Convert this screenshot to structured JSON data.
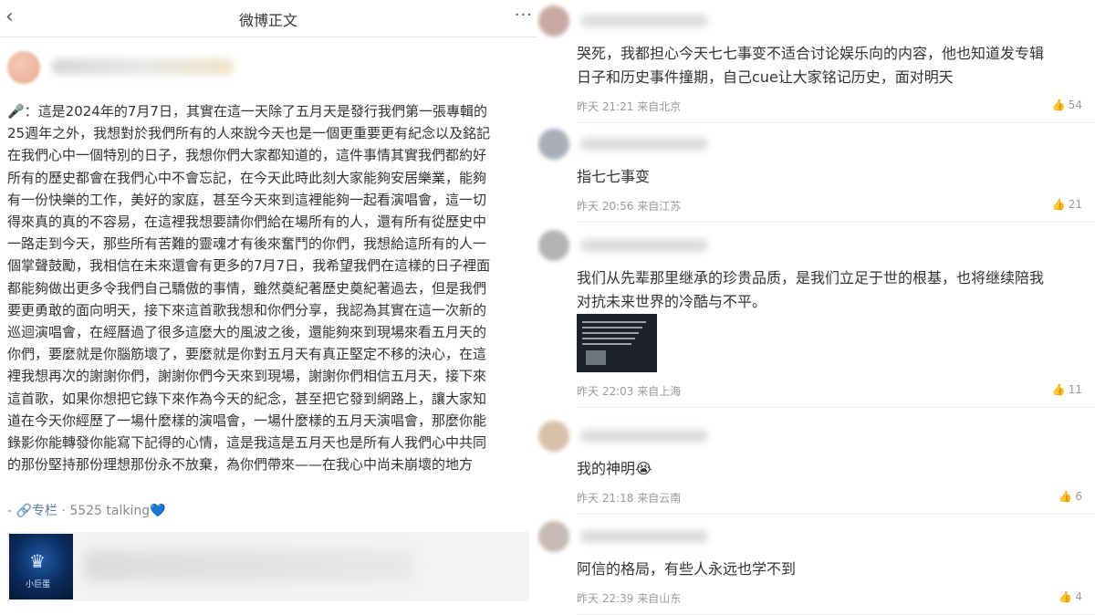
{
  "left_panel": {
    "topbar": {
      "back_icon": "‹",
      "title": "微博正文",
      "more_icon": "···"
    },
    "post_lines": [
      "🎤：這是2024年的7月7日，其實在這一天除了五月天是發行我們第一張專輯的",
      "25週年之外，我想對於我們所有的人來說今天也是一個更重要更有紀念以及銘記",
      "在我們心中一個特別的日子，我想你們大家都知道的，這件事情其實我們都約好",
      "所有的歷史都會在我們心中不會忘記，在今天此時此刻大家能夠安居樂業，能夠",
      "有一份快樂的工作，美好的家庭，甚至今天來到這裡能夠一起看演唱會，這一切",
      "得來真的真的不容易，在這裡我想要請你們給在場所有的人，還有所有從歷史中",
      "一路走到今天，那些所有苦難的靈魂才有後來奮鬥的你們，我想給這所有的人一",
      "個掌聲鼓勵，我相信在未來還會有更多的7月7日，我希望我們在這樣的日子裡面",
      "都能夠做出更多令我們自己驕傲的事情，雖然奠紀著歷史奠紀著過去，但是我們",
      "要更勇敢的面向明天，接下來這首歌我想和你們分享，我認為其實在這一次新的",
      "巡迴演唱會，在經曆過了很多這麼大的風波之後，還能夠來到現場來看五月天的",
      "你們，要麼就是你腦筋壞了，要麼就是你對五月天有真正堅定不移的決心，在這",
      "裡我想再次的謝謝你們，謝謝你們今天來到現場，謝謝你們相信五月天，接下來",
      "這首歌，如果你想把它錄下來作為今天的紀念，甚至把它發到網路上，讓大家知",
      "道在今天你經歷了一場什麼樣的演唱會，一場什麼樣的五月天演唱會，那麼你能",
      "錄影你能轉發你能寫下記得的心情，這是我這是五月天也是所有人我們心中共同",
      "的那份堅持那份理想那份永不放棄，為你們帶來——在我心中尚未崩壞的地方"
    ],
    "meta": {
      "prefix": "- ",
      "link_icon": "🔗",
      "column_label": "专栏",
      "separator": " · ",
      "talking_label": "5525 talking",
      "heart_icon": "💙"
    },
    "card": {
      "thumb_logo": "♛",
      "thumb_sub": "小巨蛋"
    }
  },
  "comments": [
    {
      "lines": [
        "哭死，我都担心今天七七事变不适合讨论娱乐向的内容，他也知道发专辑",
        "日子和历史事件撞期，自己cue让大家铭记历史，面对明天"
      ],
      "meta": "昨天 21:21 来自北京",
      "likes": "54",
      "avatar_color": "#c9a9a4"
    },
    {
      "lines": [
        "指七七事变"
      ],
      "meta": "昨天 20:56 来自江苏",
      "likes": "21",
      "avatar_color": "#a9aeb8"
    },
    {
      "lines": [
        "我们从先辈那里继承的珍贵品质，是我们立足于世的根基，也将继续陪我",
        "对抗未来世界的冷酷与不平。"
      ],
      "meta": "昨天 22:03 来自上海",
      "likes": "11",
      "avatar_color": "#b4b4b4"
    },
    {
      "lines": [
        "我的神明😭"
      ],
      "meta": "昨天 21:18 来自云南",
      "likes": "6",
      "avatar_color": "#d7c1a7"
    },
    {
      "lines": [
        "阿信的格局，有些人永远也学不到"
      ],
      "meta": "昨天 22:39 来自山东",
      "likes": "4",
      "avatar_color": "#c7b9b3"
    }
  ],
  "like_icon": "👍"
}
